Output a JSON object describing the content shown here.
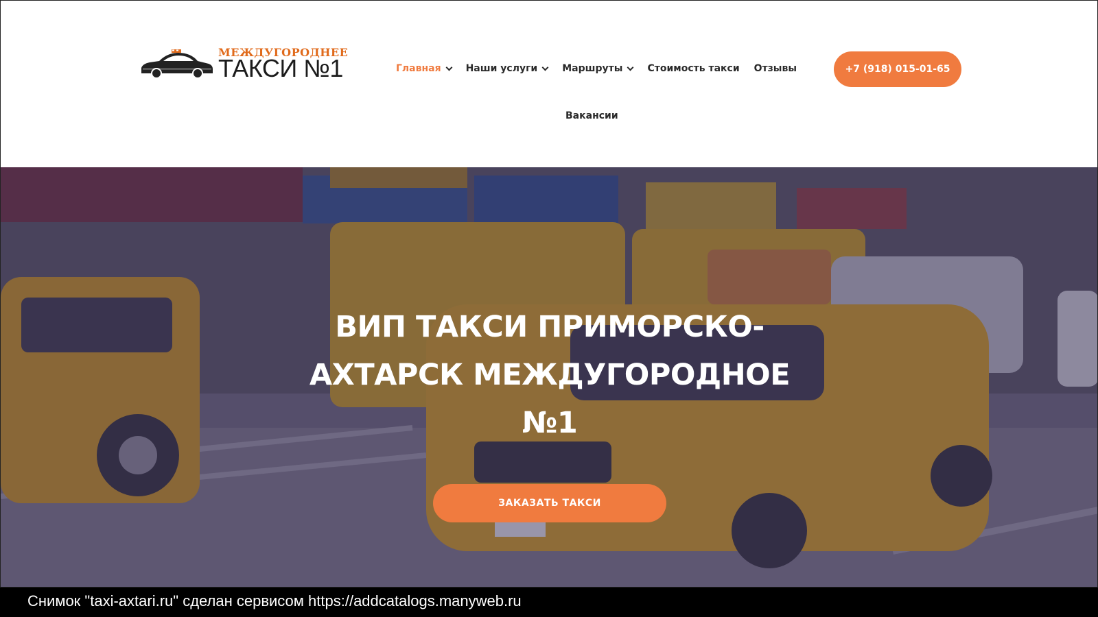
{
  "corner_mark": "<",
  "logo": {
    "top_text": "МЕЖДУГОРОДНЕЕ",
    "main_text": "ТАКСИ №1"
  },
  "nav": {
    "items": [
      {
        "label": "Главная",
        "active": true,
        "dropdown": true
      },
      {
        "label": "Наши услуги",
        "active": false,
        "dropdown": true
      },
      {
        "label": "Маршруты",
        "active": false,
        "dropdown": true
      },
      {
        "label": "Стоимость такси",
        "active": false,
        "dropdown": false
      },
      {
        "label": "Отзывы",
        "active": false,
        "dropdown": false
      }
    ],
    "second_row": "Вакансии"
  },
  "phone_button": "+7 (918) 015-01-65",
  "hero": {
    "title": "ВИП ТАКСИ ПРИМОРСКО-АХТАРСК МЕЖДУГОРОДНОЕ №1",
    "order_button": "ЗАКАЗАТЬ ТАКСИ"
  },
  "caption": "Снимок \"taxi-axtari.ru\" сделан сервисом https://addcatalogs.manyweb.ru",
  "colors": {
    "accent": "#f07b3f",
    "logo_accent": "#e06a1b",
    "text_dark": "#2a2a2a",
    "hero_overlay": "#3c345a"
  }
}
